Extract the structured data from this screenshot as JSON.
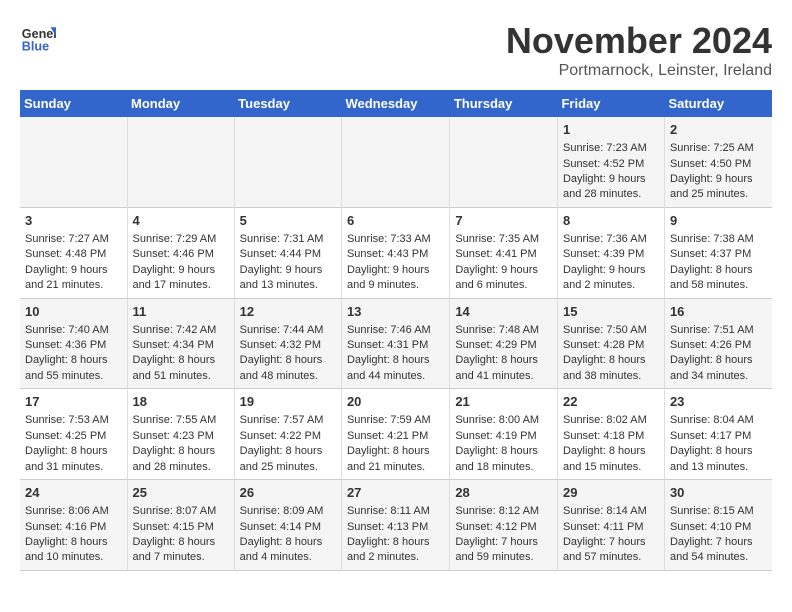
{
  "header": {
    "logo_line1": "General",
    "logo_line2": "Blue",
    "month": "November 2024",
    "location": "Portmarnock, Leinster, Ireland"
  },
  "weekdays": [
    "Sunday",
    "Monday",
    "Tuesday",
    "Wednesday",
    "Thursday",
    "Friday",
    "Saturday"
  ],
  "weeks": [
    [
      {
        "day": "",
        "info": ""
      },
      {
        "day": "",
        "info": ""
      },
      {
        "day": "",
        "info": ""
      },
      {
        "day": "",
        "info": ""
      },
      {
        "day": "",
        "info": ""
      },
      {
        "day": "1",
        "info": "Sunrise: 7:23 AM\nSunset: 4:52 PM\nDaylight: 9 hours\nand 28 minutes."
      },
      {
        "day": "2",
        "info": "Sunrise: 7:25 AM\nSunset: 4:50 PM\nDaylight: 9 hours\nand 25 minutes."
      }
    ],
    [
      {
        "day": "3",
        "info": "Sunrise: 7:27 AM\nSunset: 4:48 PM\nDaylight: 9 hours\nand 21 minutes."
      },
      {
        "day": "4",
        "info": "Sunrise: 7:29 AM\nSunset: 4:46 PM\nDaylight: 9 hours\nand 17 minutes."
      },
      {
        "day": "5",
        "info": "Sunrise: 7:31 AM\nSunset: 4:44 PM\nDaylight: 9 hours\nand 13 minutes."
      },
      {
        "day": "6",
        "info": "Sunrise: 7:33 AM\nSunset: 4:43 PM\nDaylight: 9 hours\nand 9 minutes."
      },
      {
        "day": "7",
        "info": "Sunrise: 7:35 AM\nSunset: 4:41 PM\nDaylight: 9 hours\nand 6 minutes."
      },
      {
        "day": "8",
        "info": "Sunrise: 7:36 AM\nSunset: 4:39 PM\nDaylight: 9 hours\nand 2 minutes."
      },
      {
        "day": "9",
        "info": "Sunrise: 7:38 AM\nSunset: 4:37 PM\nDaylight: 8 hours\nand 58 minutes."
      }
    ],
    [
      {
        "day": "10",
        "info": "Sunrise: 7:40 AM\nSunset: 4:36 PM\nDaylight: 8 hours\nand 55 minutes."
      },
      {
        "day": "11",
        "info": "Sunrise: 7:42 AM\nSunset: 4:34 PM\nDaylight: 8 hours\nand 51 minutes."
      },
      {
        "day": "12",
        "info": "Sunrise: 7:44 AM\nSunset: 4:32 PM\nDaylight: 8 hours\nand 48 minutes."
      },
      {
        "day": "13",
        "info": "Sunrise: 7:46 AM\nSunset: 4:31 PM\nDaylight: 8 hours\nand 44 minutes."
      },
      {
        "day": "14",
        "info": "Sunrise: 7:48 AM\nSunset: 4:29 PM\nDaylight: 8 hours\nand 41 minutes."
      },
      {
        "day": "15",
        "info": "Sunrise: 7:50 AM\nSunset: 4:28 PM\nDaylight: 8 hours\nand 38 minutes."
      },
      {
        "day": "16",
        "info": "Sunrise: 7:51 AM\nSunset: 4:26 PM\nDaylight: 8 hours\nand 34 minutes."
      }
    ],
    [
      {
        "day": "17",
        "info": "Sunrise: 7:53 AM\nSunset: 4:25 PM\nDaylight: 8 hours\nand 31 minutes."
      },
      {
        "day": "18",
        "info": "Sunrise: 7:55 AM\nSunset: 4:23 PM\nDaylight: 8 hours\nand 28 minutes."
      },
      {
        "day": "19",
        "info": "Sunrise: 7:57 AM\nSunset: 4:22 PM\nDaylight: 8 hours\nand 25 minutes."
      },
      {
        "day": "20",
        "info": "Sunrise: 7:59 AM\nSunset: 4:21 PM\nDaylight: 8 hours\nand 21 minutes."
      },
      {
        "day": "21",
        "info": "Sunrise: 8:00 AM\nSunset: 4:19 PM\nDaylight: 8 hours\nand 18 minutes."
      },
      {
        "day": "22",
        "info": "Sunrise: 8:02 AM\nSunset: 4:18 PM\nDaylight: 8 hours\nand 15 minutes."
      },
      {
        "day": "23",
        "info": "Sunrise: 8:04 AM\nSunset: 4:17 PM\nDaylight: 8 hours\nand 13 minutes."
      }
    ],
    [
      {
        "day": "24",
        "info": "Sunrise: 8:06 AM\nSunset: 4:16 PM\nDaylight: 8 hours\nand 10 minutes."
      },
      {
        "day": "25",
        "info": "Sunrise: 8:07 AM\nSunset: 4:15 PM\nDaylight: 8 hours\nand 7 minutes."
      },
      {
        "day": "26",
        "info": "Sunrise: 8:09 AM\nSunset: 4:14 PM\nDaylight: 8 hours\nand 4 minutes."
      },
      {
        "day": "27",
        "info": "Sunrise: 8:11 AM\nSunset: 4:13 PM\nDaylight: 8 hours\nand 2 minutes."
      },
      {
        "day": "28",
        "info": "Sunrise: 8:12 AM\nSunset: 4:12 PM\nDaylight: 7 hours\nand 59 minutes."
      },
      {
        "day": "29",
        "info": "Sunrise: 8:14 AM\nSunset: 4:11 PM\nDaylight: 7 hours\nand 57 minutes."
      },
      {
        "day": "30",
        "info": "Sunrise: 8:15 AM\nSunset: 4:10 PM\nDaylight: 7 hours\nand 54 minutes."
      }
    ]
  ]
}
